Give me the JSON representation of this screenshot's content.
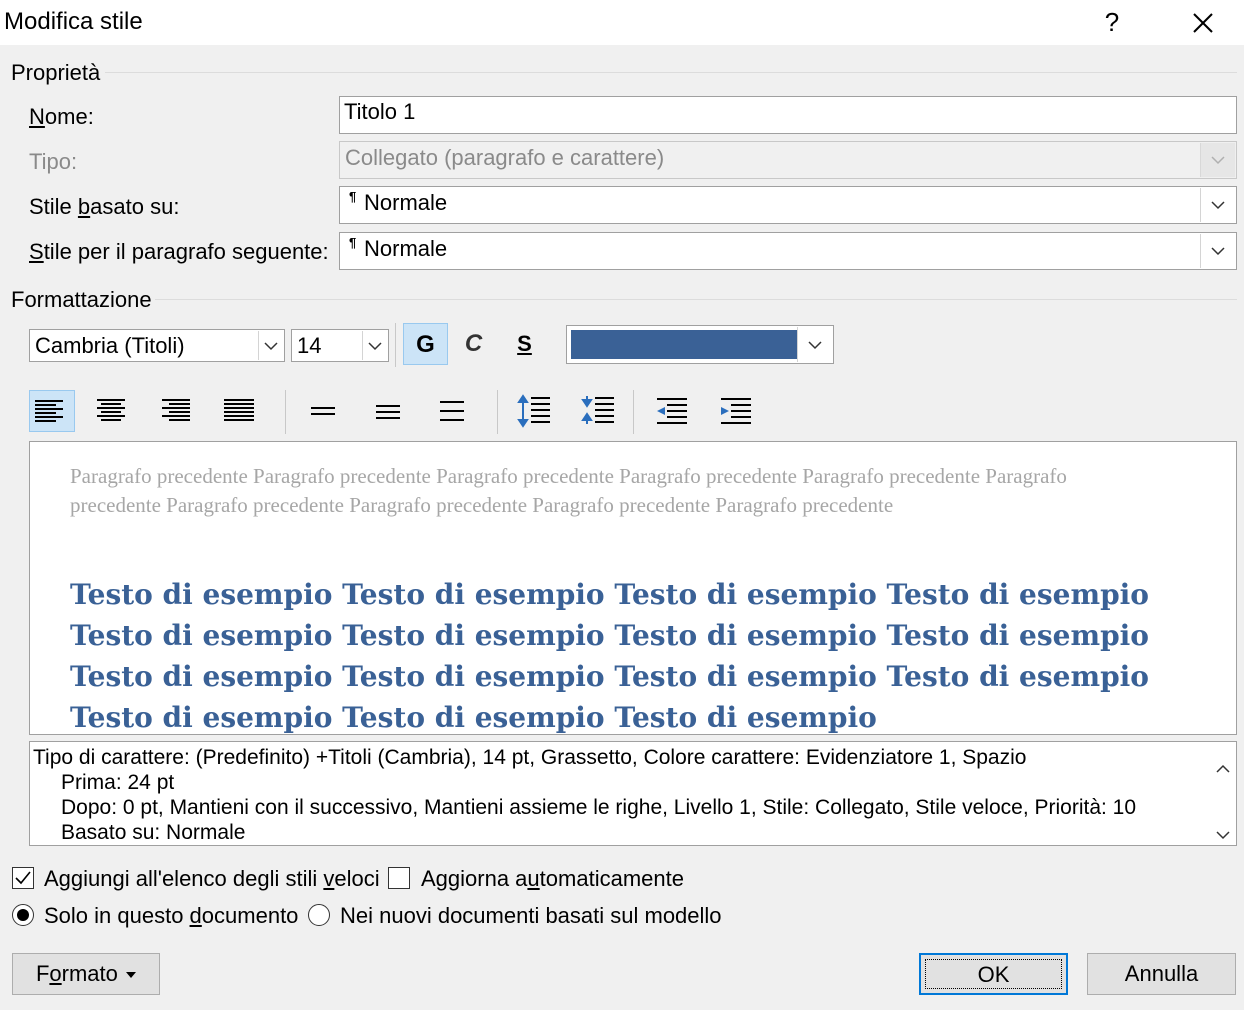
{
  "window": {
    "title": "Modifica stile",
    "help_label": "?"
  },
  "properties": {
    "section_label": "Proprietà",
    "name_label_u": "N",
    "name_label_rest": "ome:",
    "name_value": "Titolo 1",
    "type_label": "Tipo:",
    "type_value": "Collegato (paragrafo e carattere)",
    "based_on_label_pre": "Stile ",
    "based_on_label_u": "b",
    "based_on_label_post": "asato su:",
    "based_on_value": "Normale",
    "next_label_u": "S",
    "next_label_rest": "tile per il paragrafo seguente:",
    "next_value": "Normale",
    "para_mark": "¶"
  },
  "formatting": {
    "section_label": "Formattazione",
    "font_value": "Cambria (Titoli)",
    "size_value": "14",
    "bold_label": "G",
    "italic_label": "C",
    "underline_label": "S",
    "font_color": "#3a6196",
    "bold_active": true,
    "alignment_selected": "left"
  },
  "preview": {
    "previous_paragraph": "Paragrafo precedente Paragrafo precedente Paragrafo precedente Paragrafo precedente Paragrafo precedente Paragrafo precedente Paragrafo precedente Paragrafo precedente Paragrafo precedente Paragrafo precedente",
    "sample_text": "Testo di esempio Testo di esempio Testo di esempio Testo di esempio Testo di esempio Testo di esempio Testo di esempio Testo di esempio Testo di esempio Testo di esempio Testo di esempio Testo di esempio Testo di esempio Testo di esempio Testo di esempio"
  },
  "description": {
    "line1": "Tipo di carattere: (Predefinito) +Titoli (Cambria), 14 pt, Grassetto, Colore carattere: Evidenziatore 1, Spazio",
    "line2": "Prima:  24 pt",
    "line3": "Dopo:  0 pt, Mantieni con il successivo, Mantieni assieme le righe, Livello 1, Stile: Collegato, Stile veloce, Priorità: 10",
    "line4": "Basato su: Normale"
  },
  "options": {
    "add_quick_pre": "Aggiungi all'elenco degli stili ",
    "add_quick_u": "v",
    "add_quick_post": "eloci",
    "add_quick_checked": true,
    "auto_update_pre": "Aggiorna a",
    "auto_update_u": "u",
    "auto_update_post": "tomaticamente",
    "auto_update_checked": false,
    "only_doc_pre": "Solo in questo ",
    "only_doc_u": "d",
    "only_doc_post": "ocumento",
    "only_doc_selected": true,
    "new_docs_label": "Nei nuovi documenti basati sul modello",
    "new_docs_selected": false
  },
  "buttons": {
    "format_u": "o",
    "format_pre": "F",
    "format_post": "rmato",
    "ok": "OK",
    "cancel": "Annulla"
  }
}
